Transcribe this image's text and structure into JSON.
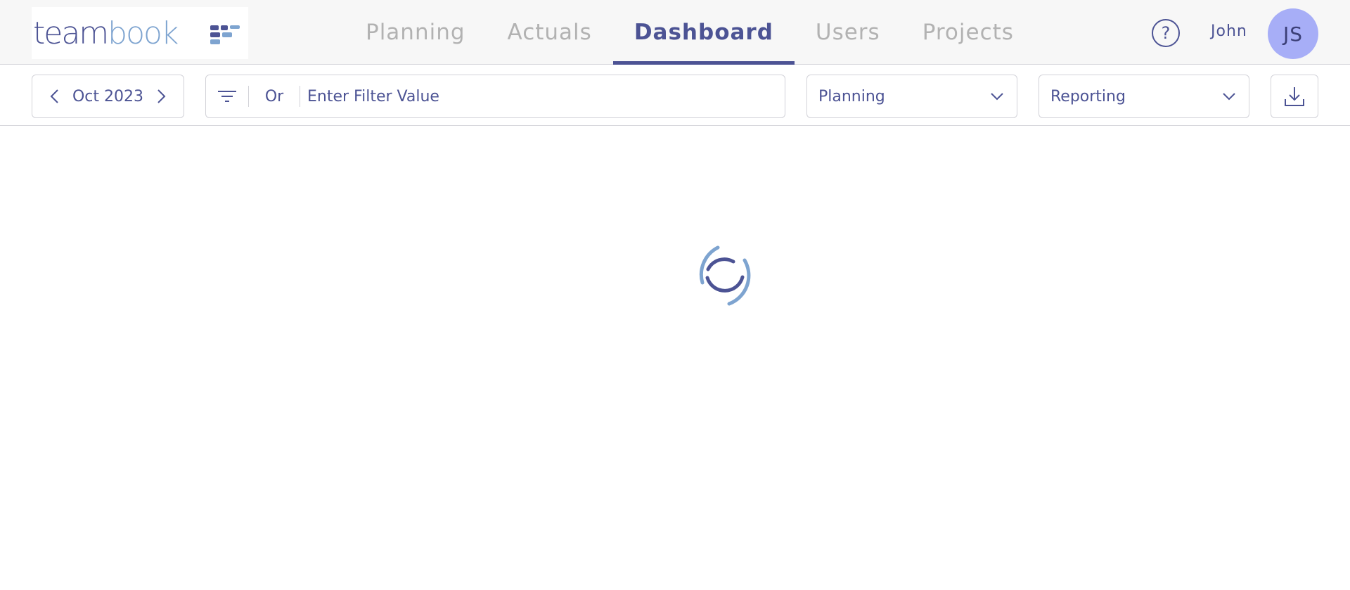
{
  "logo": {
    "part1": "team",
    "part2": "book"
  },
  "nav": {
    "tabs": [
      {
        "label": "Planning"
      },
      {
        "label": "Actuals"
      },
      {
        "label": "Dashboard",
        "active": true
      },
      {
        "label": "Users"
      },
      {
        "label": "Projects"
      }
    ]
  },
  "user": {
    "help_symbol": "?",
    "name": "John",
    "initials": "JS"
  },
  "toolbar": {
    "date": "Oct 2023",
    "filter_mode": "Or",
    "filter_placeholder": "Enter Filter Value",
    "view_select": "Planning",
    "report_select": "Reporting"
  },
  "colors": {
    "accent": "#4c5394",
    "light_accent": "#7ea4d0",
    "avatar_bg": "#a7aef7",
    "inactive_tab": "#b2b2b2"
  },
  "icons": [
    "chevron-left-icon",
    "chevron-right-icon",
    "filter-icon",
    "chevron-down-icon",
    "download-icon",
    "help-icon",
    "loading-spinner-icon"
  ]
}
